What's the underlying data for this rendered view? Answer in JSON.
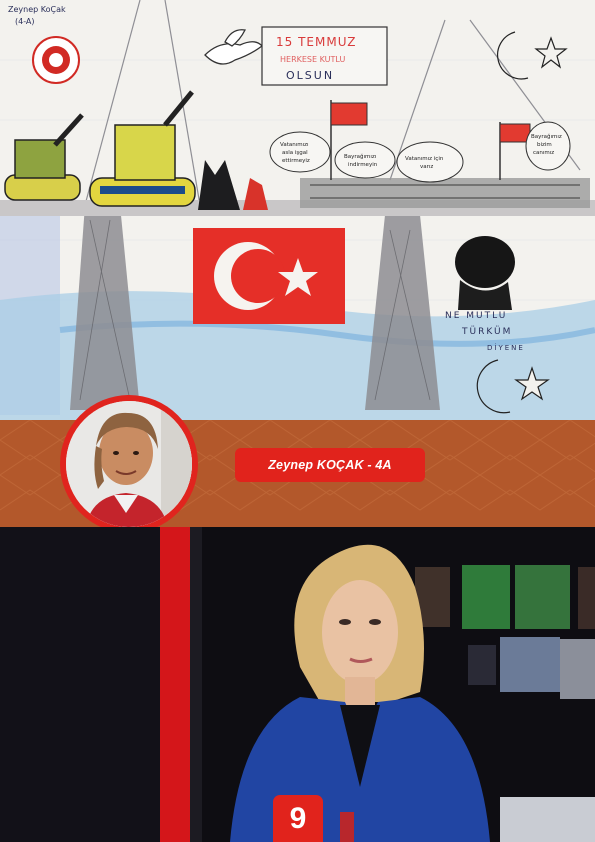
{
  "drawing": {
    "artist_tag": [
      "Zeynep KoÇak",
      "(4-A)"
    ],
    "date_sign": [
      "15 TEMMUZ",
      "HERKESE KUTLU",
      "OLSUN"
    ],
    "speech_bubbles": [
      [
        "Vatanımızı",
        "asla işgal",
        "ettirmeyiz"
      ],
      [
        "Bayrağımızı",
        "indirmeyin"
      ],
      [
        "Vatanımız için",
        "varız"
      ],
      [
        "Bayrağımız",
        "bizim",
        "canımız"
      ]
    ],
    "ataturk_quote": [
      "NE MUTLU",
      "TÜRKÜM",
      "DİYENE"
    ]
  },
  "caption": {
    "student_name": "Zeynep KOÇAK - 4A"
  },
  "footer": {
    "page_number": "9"
  },
  "colors": {
    "brand_red": "#e1231c",
    "banner_brown": "#b3582b",
    "news_dark": "#0d0c11"
  }
}
